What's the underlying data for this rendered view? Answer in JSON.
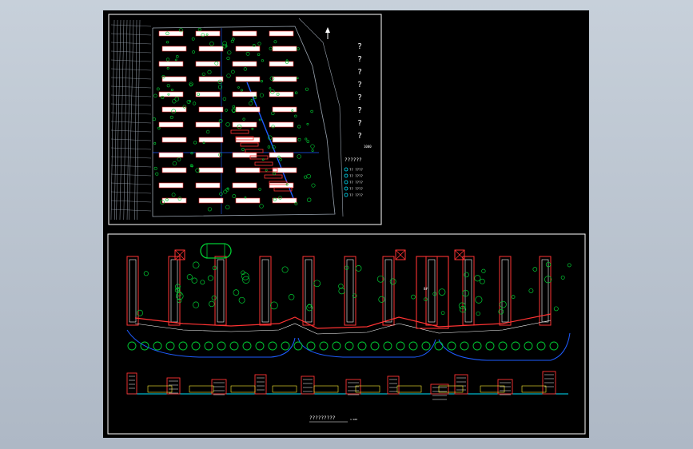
{
  "drawing": {
    "site_plan": {
      "legend_marks": [
        "?",
        "?",
        "?",
        "?",
        "?",
        "?",
        "?",
        "?"
      ],
      "legend_note": "1000",
      "legend_title": "??????",
      "legend_rows": [
        "?? ????",
        "?? ????",
        "?? ????",
        "?? ????",
        "?? ????"
      ]
    },
    "elevation": {
      "building_tag": "8#",
      "caption": "?????????",
      "caption_scale": "1:100"
    },
    "colors": {
      "background": "#000000",
      "frame": "#ffffff",
      "building_outline": "#ff3333",
      "building_fill": "#ffffff",
      "trees": "#00cc33",
      "roads": "#1e5cff",
      "grid": "#9aa4b0",
      "accent": "#00e5ff"
    }
  }
}
